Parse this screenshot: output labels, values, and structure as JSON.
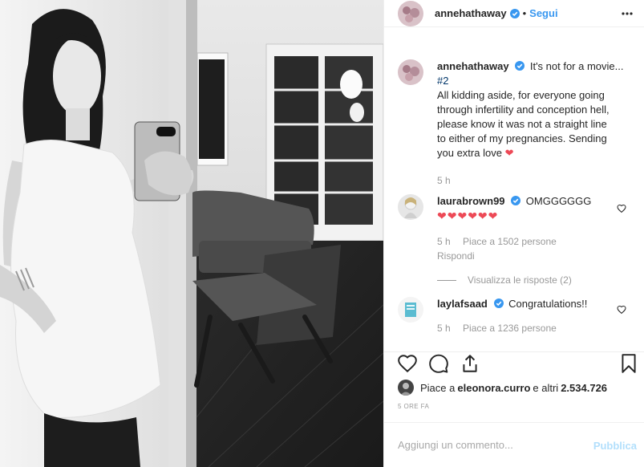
{
  "post": {
    "username": "annehathaway",
    "follow_label": "Segui",
    "dot": "•"
  },
  "caption": {
    "username": "annehathaway",
    "text": "It's not for a movie... #2\nAll kidding aside, for everyone going through infertility and conception hell, please know it was not a straight line to either of my pregnancies. Sending you extra love",
    "line1": "It's not for a movie...",
    "line2": "#2",
    "line3": "All kidding aside, for everyone going",
    "line4": "through infertility and conception hell,",
    "line5": "please know it was not a straight line",
    "line6": "to either of my pregnancies. Sending",
    "line7": "you extra love",
    "time": "5 h"
  },
  "comments": [
    {
      "username": "laurabrown99",
      "text": "OMGGGGGG",
      "hearts": "❤❤❤❤❤❤",
      "time": "5 h",
      "likes": "Piace a 1502 persone",
      "reply": "Rispondi",
      "view_replies": "Visualizza le risposte (2)"
    },
    {
      "username": "laylafsaad",
      "text": "Congratulations!!",
      "time": "5 h",
      "likes": "Piace a 1236 persone"
    }
  ],
  "likes": {
    "prefix": "Piace a ",
    "user": "eleonora.curro",
    "middle": " e altri ",
    "count": "2.534.726"
  },
  "timestamp": "5 ORE FA",
  "composer": {
    "placeholder": "Aggiungi un commento...",
    "publish": "Pubblica"
  },
  "colors": {
    "link": "#3897f0",
    "verified": "#3897f0",
    "heart": "#ed4956",
    "muted": "#999999",
    "publish_disabled": "#b2dffc"
  },
  "icons": [
    "heart-icon",
    "comment-icon",
    "share-icon",
    "bookmark-icon",
    "more-icon",
    "verified-icon"
  ]
}
